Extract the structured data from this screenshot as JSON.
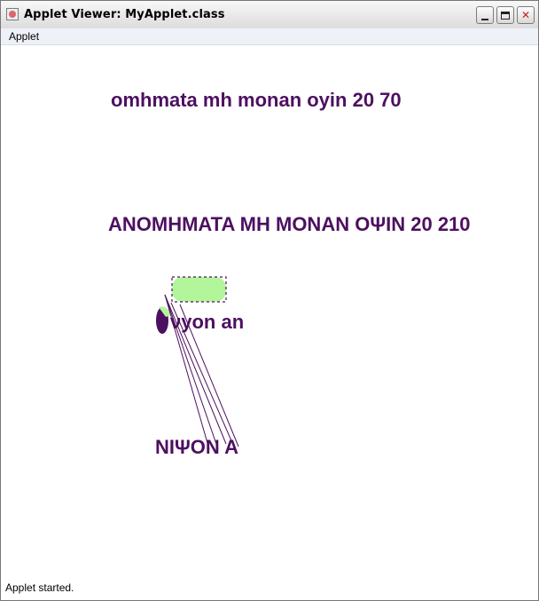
{
  "window": {
    "title": "Applet Viewer: MyApplet.class",
    "icon": "java-applet-icon",
    "controls": {
      "minimize": "minimize-icon",
      "maximize": "maximize-icon",
      "close": "✕"
    }
  },
  "menubar": {
    "items": [
      "Applet"
    ]
  },
  "canvas": {
    "colors": {
      "text": "#4d1060",
      "fill": "#b3f59a",
      "stroke": "#4d1060"
    },
    "texts": {
      "line1": "omhmata mh monan oyin 20 70",
      "line2": "ANOMHMATA MH MONAN OΨIN 20 210",
      "line3": "νyon an",
      "line4": "NIΨON A"
    }
  },
  "status": {
    "text": "Applet started."
  }
}
